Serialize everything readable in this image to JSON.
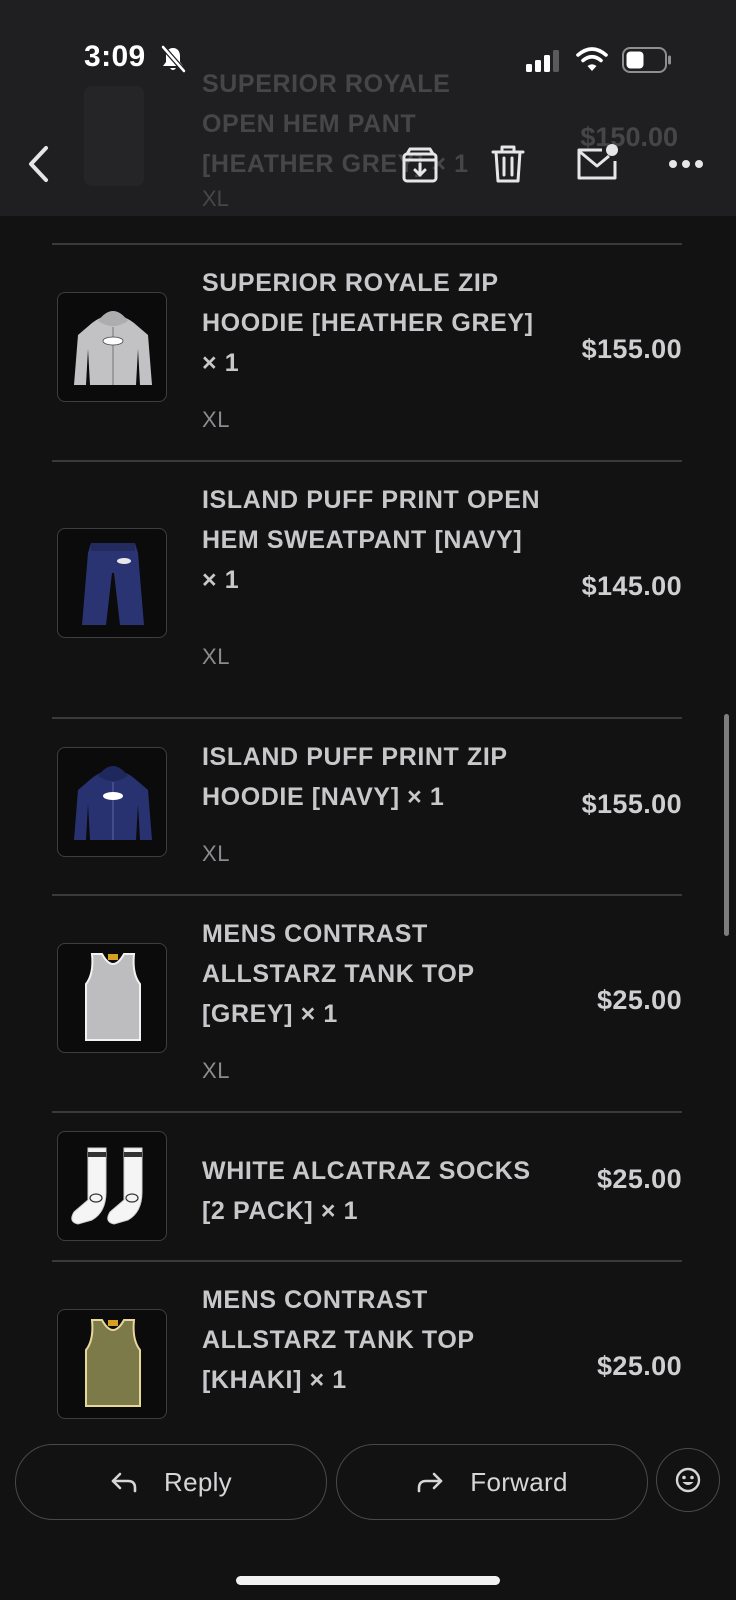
{
  "status_bar": {
    "time": "3:09",
    "icons": [
      "bell-slash-icon",
      "cellular-signal-icon",
      "wifi-icon",
      "battery-icon"
    ]
  },
  "toolbar": {
    "icons": [
      "back-chevron-icon",
      "archive-icon",
      "trash-icon",
      "mark-unread-icon",
      "more-icon"
    ]
  },
  "previous_item": {
    "title": "SUPERIOR ROYALE OPEN HEM PANT [HEATHER GREY] × 1",
    "price": "$150.00",
    "size": "XL"
  },
  "order_items": [
    {
      "title": "SUPERIOR ROYALE ZIP HOODIE [HEATHER GREY] × 1",
      "size": "XL",
      "price": "$155.00",
      "image": "grey-zip-hoodie"
    },
    {
      "title": "ISLAND PUFF PRINT OPEN HEM SWEATPANT [NAVY] × 1",
      "size": "XL",
      "price": "$145.00",
      "image": "navy-sweatpant"
    },
    {
      "title": "ISLAND PUFF PRINT ZIP HOODIE [NAVY] × 1",
      "size": "XL",
      "price": "$155.00",
      "image": "navy-zip-hoodie"
    },
    {
      "title": "MENS CONTRAST ALLSTARZ TANK TOP [GREY] × 1",
      "size": "XL",
      "price": "$25.00",
      "image": "grey-tank-top"
    },
    {
      "title": "WHITE ALCATRAZ SOCKS [2 PACK] × 1",
      "size": "",
      "price": "$25.00",
      "image": "white-socks"
    },
    {
      "title": "MENS CONTRAST ALLSTARZ TANK TOP [KHAKI] × 1",
      "size": "",
      "price": "$25.00",
      "image": "khaki-tank-top"
    }
  ],
  "actions": {
    "reply_label": "Reply",
    "forward_label": "Forward",
    "emoji_icon": "smiley-icon"
  },
  "colors": {
    "background": "#121213",
    "header": "#1f1f21",
    "divider": "#3a3a3c",
    "text": "#c8c8cb",
    "muted": "#8c8c90"
  }
}
